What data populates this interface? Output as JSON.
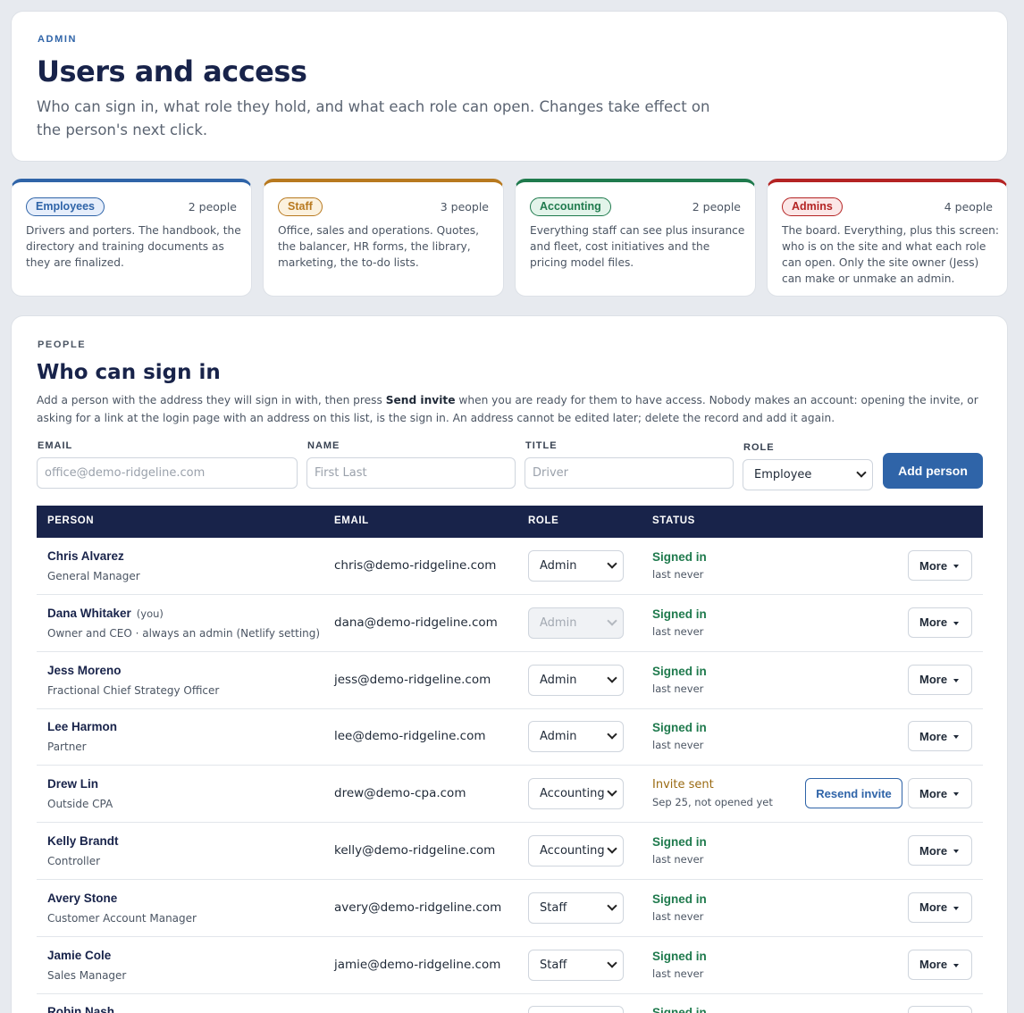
{
  "header": {
    "eyebrow": "ADMIN",
    "title": "Users and access",
    "description": "Who can sign in, what role they hold, and what each role can open. Changes take effect on the person's next click."
  },
  "roles": [
    {
      "name": "Employees",
      "count": "2 people",
      "color": "#2f64a8",
      "badge_bg": "#e6eefb",
      "description": "Drivers and porters. The handbook, the directory and training documents as they are finalized."
    },
    {
      "name": "Staff",
      "count": "3 people",
      "color": "#b8791f",
      "badge_bg": "#fbf1de",
      "description": "Office, sales and operations. Quotes, the balancer, HR forms, the library, marketing, the to-do lists."
    },
    {
      "name": "Accounting",
      "count": "2 people",
      "color": "#1f7a4d",
      "badge_bg": "#e3f4ea",
      "description": "Everything staff can see plus insurance and fleet, cost initiatives and the pricing model files."
    },
    {
      "name": "Admins",
      "count": "4 people",
      "color": "#b42323",
      "badge_bg": "#fbe7e7",
      "description": "The board. Everything, plus this screen: who is on the site and what each role can open. Only the site owner (Jess) can make or unmake an admin."
    }
  ],
  "people": {
    "eyebrow": "PEOPLE",
    "title": "Who can sign in",
    "intro_before": "Add a person with the address they will sign in with, then press ",
    "intro_bold": "Send invite",
    "intro_after": " when you are ready for them to have access. Nobody makes an account: opening the invite, or asking for a link at the login page with an address on this list, is the sign in. An address cannot be edited later; delete the record and add it again.",
    "form": {
      "email_label": "EMAIL",
      "email_placeholder": "office@demo-ridgeline.com",
      "name_label": "NAME",
      "name_placeholder": "First Last",
      "title_label": "TITLE",
      "title_placeholder": "Driver",
      "role_label": "ROLE",
      "role_value": "Employee",
      "add_button": "Add person"
    },
    "table": {
      "headers": [
        "PERSON",
        "EMAIL",
        "ROLE",
        "STATUS"
      ],
      "more_label": "More",
      "resend_label": "Resend invite",
      "rows": [
        {
          "name": "Chris Alvarez",
          "you": "",
          "title": "General Manager",
          "email": "chris@demo-ridgeline.com",
          "role": "Admin",
          "role_disabled": false,
          "status": "Signed in",
          "status_kind": "ok",
          "status_sub": "last never",
          "resend": false
        },
        {
          "name": "Dana Whitaker",
          "you": "(you)",
          "title": "Owner and CEO · always an admin (Netlify setting)",
          "email": "dana@demo-ridgeline.com",
          "role": "Admin",
          "role_disabled": true,
          "status": "Signed in",
          "status_kind": "ok",
          "status_sub": "last never",
          "resend": false
        },
        {
          "name": "Jess Moreno",
          "you": "",
          "title": "Fractional Chief Strategy Officer",
          "email": "jess@demo-ridgeline.com",
          "role": "Admin",
          "role_disabled": false,
          "status": "Signed in",
          "status_kind": "ok",
          "status_sub": "last never",
          "resend": false
        },
        {
          "name": "Lee Harmon",
          "you": "",
          "title": "Partner",
          "email": "lee@demo-ridgeline.com",
          "role": "Admin",
          "role_disabled": false,
          "status": "Signed in",
          "status_kind": "ok",
          "status_sub": "last never",
          "resend": false
        },
        {
          "name": "Drew Lin",
          "you": "",
          "title": "Outside CPA",
          "email": "drew@demo-cpa.com",
          "role": "Accounting",
          "role_disabled": false,
          "status": "Invite sent",
          "status_kind": "pending",
          "status_sub": "Sep 25, not opened yet",
          "resend": true
        },
        {
          "name": "Kelly Brandt",
          "you": "",
          "title": "Controller",
          "email": "kelly@demo-ridgeline.com",
          "role": "Accounting",
          "role_disabled": false,
          "status": "Signed in",
          "status_kind": "ok",
          "status_sub": "last never",
          "resend": false
        },
        {
          "name": "Avery Stone",
          "you": "",
          "title": "Customer Account Manager",
          "email": "avery@demo-ridgeline.com",
          "role": "Staff",
          "role_disabled": false,
          "status": "Signed in",
          "status_kind": "ok",
          "status_sub": "last never",
          "resend": false
        },
        {
          "name": "Jamie Cole",
          "you": "",
          "title": "Sales Manager",
          "email": "jamie@demo-ridgeline.com",
          "role": "Staff",
          "role_disabled": false,
          "status": "Signed in",
          "status_kind": "ok",
          "status_sub": "last never",
          "resend": false
        },
        {
          "name": "Robin Nash",
          "you": "",
          "title": "",
          "email": "",
          "role": "",
          "role_disabled": false,
          "status": "Signed in",
          "status_kind": "ok",
          "status_sub": "",
          "resend": false
        }
      ]
    }
  }
}
